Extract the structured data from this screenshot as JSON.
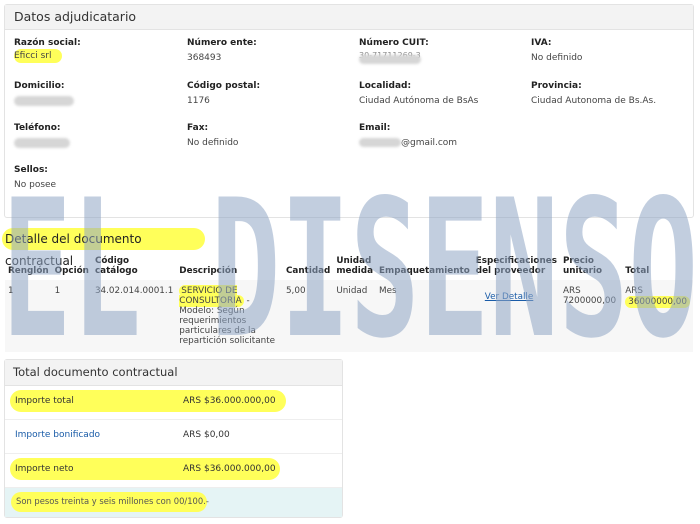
{
  "adjudicatario": {
    "title": "Datos adjudicatario",
    "razon_social_label": "Razón social:",
    "razon_social": "Eficci srl",
    "numero_ente_label": "Número ente:",
    "numero_ente": "368493",
    "cuit_label": "Número CUIT:",
    "cuit_partial": "30-71711269-3",
    "iva_label": "IVA:",
    "iva": "No definido",
    "domicilio_label": "Domicilio:",
    "codigo_postal_label": "Código postal:",
    "codigo_postal": "1176",
    "localidad_label": "Localidad:",
    "localidad": "Ciudad Autónoma de BsAs",
    "provincia_label": "Provincia:",
    "provincia": "Ciudad Autonoma de Bs.As.",
    "telefono_label": "Teléfono:",
    "fax_label": "Fax:",
    "fax": "No definido",
    "email_label": "Email:",
    "email_suffix": "@gmail.com",
    "sellos_label": "Sellos:",
    "sellos": "No posee"
  },
  "detalle": {
    "title": "Detalle del documento contractual",
    "headers": {
      "renglon": "Renglón",
      "opcion": "Opción",
      "codigo": "Código catálogo",
      "descripcion": "Descripción",
      "cantidad": "Cantidad",
      "unidad": "Unidad medida",
      "empaquetamiento": "Empaquetamiento",
      "especificaciones": "Especificaciones del proveedor",
      "precio": "Precio unitario",
      "total": "Total"
    },
    "row": {
      "renglon": "1",
      "opcion": "1",
      "codigo": "34.02.014.0001.1",
      "descripcion_main": "SERVICIO DE CONSULTORIA",
      "descripcion_rest": " - Modelo: Según requerimientos particulares de la repartición solicitante",
      "cantidad": "5,00",
      "unidad": "Unidad",
      "empaquetamiento": "Mes",
      "especificaciones_link": "Ver Detalle",
      "precio_currency": "ARS",
      "precio": "7200000,00",
      "total_currency": "ARS",
      "total": "36000000,00"
    }
  },
  "totales": {
    "title": "Total documento contractual",
    "importe_total_label": "Importe total",
    "importe_total": "ARS $36.000.000,00",
    "importe_bonificado_label": "Importe bonificado",
    "importe_bonificado": "ARS $0,00",
    "importe_neto_label": "Importe neto",
    "importe_neto": "ARS $36.000.000,00",
    "en_letras": "Son pesos treinta y seis millones con 00/100.-"
  },
  "watermark": "EL DISENSO",
  "colors": {
    "highlight": "#ffff5a",
    "link": "#1a5ca8",
    "watermark": "#8fa6c4"
  }
}
